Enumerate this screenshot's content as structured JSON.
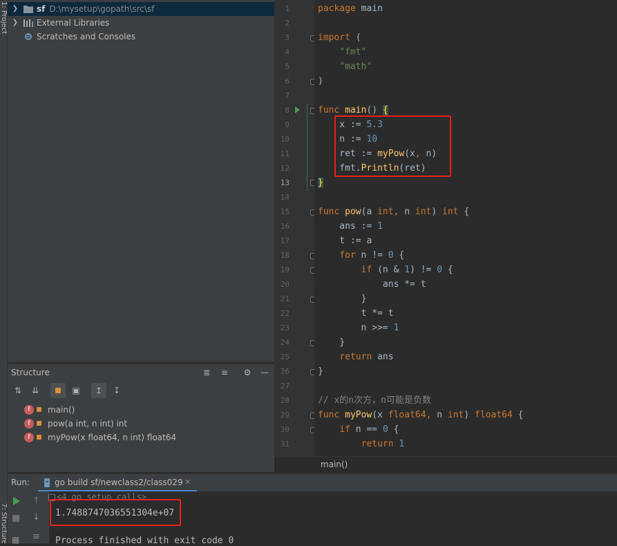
{
  "left_strip": {
    "project_tab": "1: Project",
    "structure_tab": "7: Structure"
  },
  "project_tree": [
    {
      "name": "sf",
      "path": "D:\\mysetup\\gopath\\src\\sf",
      "icon": "folder-icon",
      "selected": true
    },
    {
      "name": "External Libraries",
      "path": "",
      "icon": "library-icon",
      "selected": false
    },
    {
      "name": "Scratches and Consoles",
      "path": "",
      "icon": "scratches-icon",
      "selected": false
    }
  ],
  "structure": {
    "title": "Structure",
    "items": [
      {
        "badge": "f",
        "label": "main()"
      },
      {
        "badge": "f",
        "label": "pow(a int, n int) int"
      },
      {
        "badge": "f",
        "label": "myPow(x float64, n int) float64"
      }
    ]
  },
  "editor": {
    "line_numbers": [
      "1",
      "2",
      "3",
      "4",
      "5",
      "6",
      "7",
      "8",
      "9",
      "10",
      "11",
      "12",
      "13",
      "14",
      "15",
      "16",
      "17",
      "18",
      "19",
      "20",
      "21",
      "22",
      "23",
      "24",
      "25",
      "26",
      "27",
      "28",
      "29",
      "30",
      "31"
    ],
    "current_line": "13",
    "breadcrumb": "main()",
    "lines": [
      [
        [
          "k",
          "package "
        ],
        [
          "p",
          "main"
        ]
      ],
      [],
      [
        [
          "k",
          "import "
        ],
        [
          "p",
          "("
        ]
      ],
      [
        [
          "p",
          "    "
        ],
        [
          "s",
          "\"fmt\""
        ]
      ],
      [
        [
          "p",
          "    "
        ],
        [
          "s",
          "\"math\""
        ]
      ],
      [
        [
          "p",
          ")"
        ]
      ],
      [],
      [
        [
          "k",
          "func "
        ],
        [
          "f",
          "main"
        ],
        [
          "p",
          "() "
        ],
        [
          "b",
          "{"
        ]
      ],
      [
        [
          "p",
          "    x := "
        ],
        [
          "n",
          "5.3"
        ]
      ],
      [
        [
          "p",
          "    n := "
        ],
        [
          "n",
          "10"
        ]
      ],
      [
        [
          "p",
          "    ret := "
        ],
        [
          "f",
          "myPow"
        ],
        [
          "p",
          "(x"
        ],
        [
          "k",
          ","
        ],
        [
          "p",
          " n)"
        ]
      ],
      [
        [
          "p",
          "    fmt."
        ],
        [
          "f",
          "Println"
        ],
        [
          "p",
          "(ret)"
        ]
      ],
      [
        [
          "b",
          "}"
        ]
      ],
      [],
      [
        [
          "k",
          "func "
        ],
        [
          "f",
          "pow"
        ],
        [
          "p",
          "(a "
        ],
        [
          "k",
          "int"
        ],
        [
          "k",
          ", "
        ],
        [
          "p",
          "n "
        ],
        [
          "k",
          "int"
        ],
        [
          "p",
          ") "
        ],
        [
          "k",
          "int "
        ],
        [
          "p",
          "{"
        ]
      ],
      [
        [
          "p",
          "    ans := "
        ],
        [
          "n",
          "1"
        ]
      ],
      [
        [
          "p",
          "    t := a"
        ]
      ],
      [
        [
          "p",
          "    "
        ],
        [
          "k",
          "for "
        ],
        [
          "p",
          "n != "
        ],
        [
          "n",
          "0 "
        ],
        [
          "p",
          "{"
        ]
      ],
      [
        [
          "p",
          "        "
        ],
        [
          "k",
          "if "
        ],
        [
          "p",
          "(n & "
        ],
        [
          "n",
          "1"
        ],
        [
          "p",
          ") != "
        ],
        [
          "n",
          "0 "
        ],
        [
          "p",
          "{"
        ]
      ],
      [
        [
          "p",
          "            ans *= t"
        ]
      ],
      [
        [
          "p",
          "        }"
        ]
      ],
      [
        [
          "p",
          "        t *= t"
        ]
      ],
      [
        [
          "p",
          "        n >>= "
        ],
        [
          "n",
          "1"
        ]
      ],
      [
        [
          "p",
          "    }"
        ]
      ],
      [
        [
          "p",
          "    "
        ],
        [
          "k",
          "return "
        ],
        [
          "p",
          "ans"
        ]
      ],
      [
        [
          "p",
          "}"
        ]
      ],
      [],
      [
        [
          "c",
          "// x的n次方，n可能是负数"
        ]
      ],
      [
        [
          "k",
          "func "
        ],
        [
          "f",
          "myPow"
        ],
        [
          "p",
          "(x "
        ],
        [
          "k",
          "float64"
        ],
        [
          "k",
          ", "
        ],
        [
          "p",
          "n "
        ],
        [
          "k",
          "int"
        ],
        [
          "p",
          ") "
        ],
        [
          "k",
          "float64 "
        ],
        [
          "p",
          "{"
        ]
      ],
      [
        [
          "p",
          "    "
        ],
        [
          "k",
          "if "
        ],
        [
          "p",
          "n == "
        ],
        [
          "n",
          "0 "
        ],
        [
          "p",
          "{"
        ]
      ],
      [
        [
          "p",
          "        "
        ],
        [
          "k",
          "return "
        ],
        [
          "n",
          "1"
        ]
      ]
    ]
  },
  "run": {
    "label": "Run:",
    "tab_label": "go build sf/newclass2/class029",
    "console_prefix": "<4 go setup calls>",
    "output": "1.7488747036551304e+07",
    "finished": "Process finished with exit code 0"
  },
  "colors": {
    "highlight_box": "#e8221b",
    "selection": "#0d293e",
    "run_green": "#499c54"
  }
}
